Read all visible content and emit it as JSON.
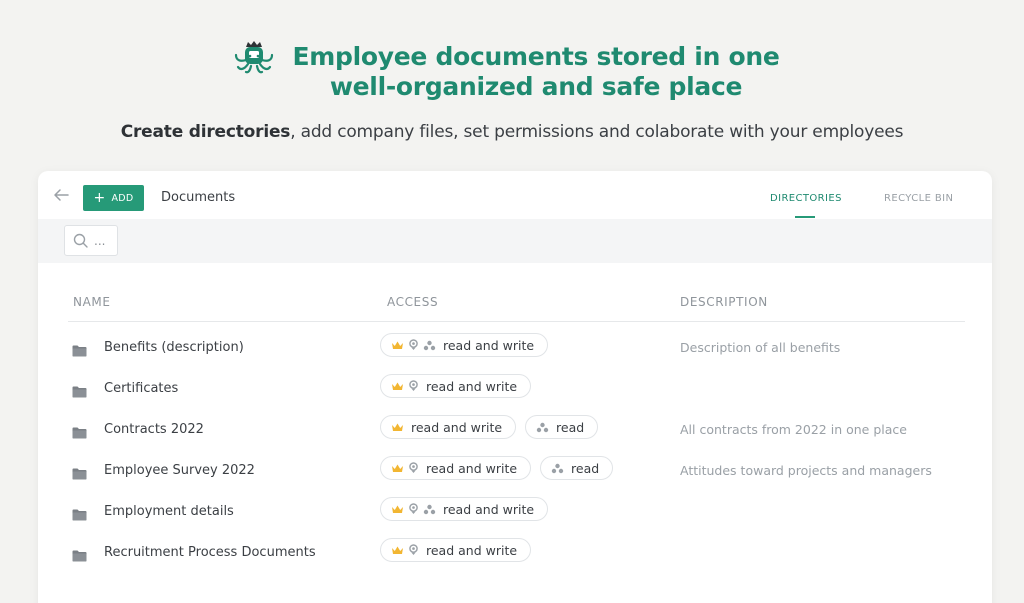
{
  "hero": {
    "headline_line1": "Employee documents stored in one",
    "headline_line2": "well-organized and safe place",
    "tagline_bold": "Create directories",
    "tagline_rest": ", add company files, set permissions and colaborate with your employees",
    "logo_icon": "octopus-logo-icon"
  },
  "colors": {
    "brand": "#1f8a70",
    "button": "#269a78",
    "crown": "#f2b632",
    "muted": "#9aa0a6"
  },
  "toolbar": {
    "back_icon": "arrow-left-icon",
    "add_label": "ADD",
    "title": "Documents"
  },
  "tabs": {
    "directories": "DIRECTORIES",
    "recycle_bin": "RECYCLE BIN"
  },
  "search": {
    "placeholder": "..."
  },
  "table": {
    "columns": {
      "name": "NAME",
      "access": "ACCESS",
      "description": "DESCRIPTION"
    },
    "rows": [
      {
        "name": "Benefits (description)",
        "badges": [
          {
            "icons": [
              "crown",
              "person",
              "group"
            ],
            "label": "read and write"
          }
        ],
        "description": "Description of all benefits"
      },
      {
        "name": "Certificates",
        "badges": [
          {
            "icons": [
              "crown",
              "person"
            ],
            "label": "read and write"
          }
        ],
        "description": ""
      },
      {
        "name": "Contracts 2022",
        "badges": [
          {
            "icons": [
              "crown"
            ],
            "label": "read and write"
          },
          {
            "icons": [
              "group"
            ],
            "label": "read"
          }
        ],
        "description": "All contracts from 2022 in one place"
      },
      {
        "name": "Employee Survey 2022",
        "badges": [
          {
            "icons": [
              "crown",
              "person"
            ],
            "label": "read and write"
          },
          {
            "icons": [
              "group"
            ],
            "label": "read"
          }
        ],
        "description": "Attitudes toward projects and managers"
      },
      {
        "name": "Employment details",
        "badges": [
          {
            "icons": [
              "crown",
              "person",
              "group"
            ],
            "label": "read and write"
          }
        ],
        "description": ""
      },
      {
        "name": "Recruitment Process Documents",
        "badges": [
          {
            "icons": [
              "crown",
              "person"
            ],
            "label": "read and write"
          }
        ],
        "description": ""
      }
    ]
  }
}
